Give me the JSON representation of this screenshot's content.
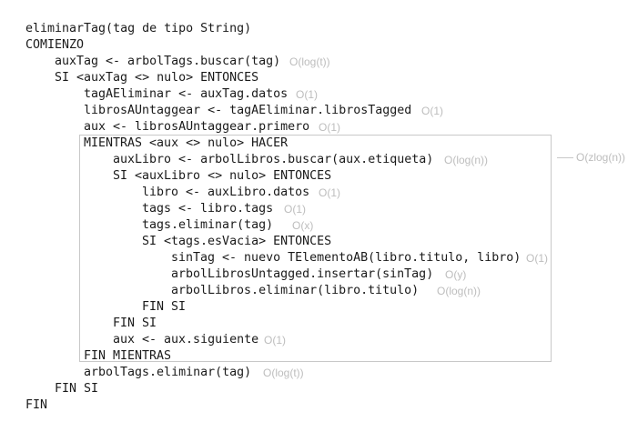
{
  "lines": [
    {
      "code": "eliminarTag(tag de tipo String)",
      "indent": 0
    },
    {
      "code": "COMIENZO",
      "indent": 0
    },
    {
      "code": "auxTag <- arbolTags.buscar(tag)",
      "indent": 1,
      "complexity": "O(log(t))"
    },
    {
      "code": "SI <auxTag <> nulo> ENTONCES",
      "indent": 1
    },
    {
      "code": "tagAEliminar <- auxTag.datos",
      "indent": 2,
      "complexity": "O(1)"
    },
    {
      "code": "librosAUntaggear <- tagAEliminar.librosTagged",
      "indent": 2,
      "complexity": "O(1)"
    },
    {
      "code": "aux <- librosAUntaggear.primero",
      "indent": 2,
      "complexity": "O(1)"
    },
    {
      "code": "MIENTRAS <aux <> nulo> HACER",
      "indent": 2
    },
    {
      "code": "auxLibro <- arbolLibros.buscar(aux.etiqueta)",
      "indent": 3,
      "complexity": "O(log(n))"
    },
    {
      "code": "SI <auxLibro <> nulo> ENTONCES",
      "indent": 3
    },
    {
      "code": "libro <- auxLibro.datos",
      "indent": 4,
      "complexity": "O(1)"
    },
    {
      "code": "tags <- libro.tags",
      "indent": 4,
      "complexity": "O(1)"
    },
    {
      "code": "tags.eliminar(tag)",
      "indent": 4,
      "complexity": "O(x)"
    },
    {
      "code": "SI <tags.esVacia> ENTONCES",
      "indent": 4
    },
    {
      "code": "sinTag <- nuevo TElementoAB(libro.titulo, libro)",
      "indent": 5,
      "complexity": "O(1)"
    },
    {
      "code": "arbolLibrosUntagged.insertar(sinTag)",
      "indent": 5,
      "complexity": "O(y)"
    },
    {
      "code": "arbolLibros.eliminar(libro.titulo)",
      "indent": 5,
      "complexity": "O(log(n))"
    },
    {
      "code": "FIN SI",
      "indent": 4
    },
    {
      "code": "FIN SI",
      "indent": 3
    },
    {
      "code": "aux <- aux.siguiente",
      "indent": 3,
      "complexity": "O(1)"
    },
    {
      "code": "FIN MIENTRAS",
      "indent": 2
    },
    {
      "code": "arbolTags.eliminar(tag)",
      "indent": 2,
      "complexity": "O(log(t))"
    },
    {
      "code": "FIN SI",
      "indent": 1
    },
    {
      "code": "FIN",
      "indent": 0
    }
  ],
  "loop_complexity": "O(zlog(n))"
}
